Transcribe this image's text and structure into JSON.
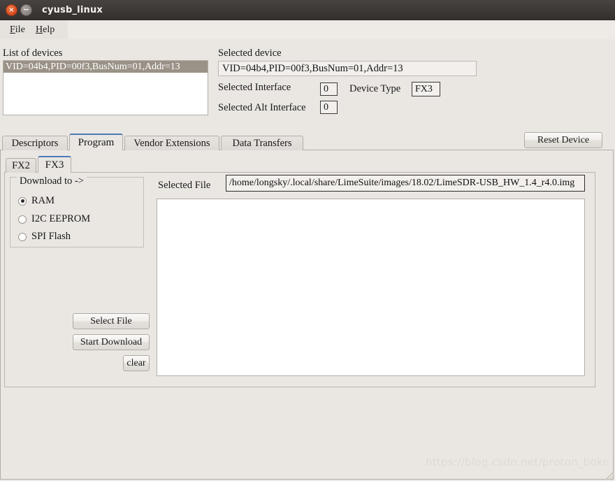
{
  "titlebar": {
    "title": "cyusb_linux",
    "close_glyph": "×",
    "minimize_glyph": "−",
    "close_icon_name": "close-icon",
    "minimize_icon_name": "minimize-icon"
  },
  "menubar": {
    "items": [
      {
        "label": "File",
        "mnemonic": "F",
        "rest": "ile"
      },
      {
        "label": "Help",
        "mnemonic": "H",
        "rest": "elp"
      }
    ]
  },
  "device_panel": {
    "list_label": "List of devices",
    "devices": [
      {
        "text": "VID=04b4,PID=00f3,BusNum=01,Addr=13",
        "selected": true
      }
    ],
    "selected_device_label": "Selected device",
    "selected_device_value": "VID=04b4,PID=00f3,BusNum=01,Addr=13",
    "selected_interface_label": "Selected Interface",
    "selected_interface_value": "0",
    "selected_alt_interface_label": "Selected Alt Interface",
    "selected_alt_interface_value": "0",
    "device_type_label": "Device Type",
    "device_type_value": "FX3"
  },
  "toolbar": {
    "reset_device_label": "Reset Device"
  },
  "main_tabs": [
    {
      "label": "Descriptors",
      "active": false
    },
    {
      "label": "Program",
      "active": true
    },
    {
      "label": "Vendor Extensions",
      "active": false
    },
    {
      "label": "Data Transfers",
      "active": false
    }
  ],
  "sub_tabs": [
    {
      "label": "FX2",
      "active": false
    },
    {
      "label": "FX3",
      "active": true
    }
  ],
  "program_panel": {
    "download_group_title": "Download to ->",
    "download_options": [
      {
        "label": "RAM",
        "selected": true
      },
      {
        "label": "I2C EEPROM",
        "selected": false
      },
      {
        "label": "SPI Flash",
        "selected": false
      }
    ],
    "selected_file_label": "Selected File",
    "selected_file_value": "/home/longsky/.local/share/LimeSuite/images/18.02/LimeSDR-USB_HW_1.4_r4.0.img",
    "output_text": "",
    "select_file_label": "Select File",
    "start_download_label": "Start Download",
    "clear_label": "clear"
  },
  "watermark": {
    "text": "https://blog.csdn.net/proton_boke"
  },
  "colors": {
    "window_background": "#eae7e3",
    "titlebar": "#3c3836",
    "accent_tab": "#4a7ab5",
    "list_selection": "#9a9287",
    "close_button": "#da5024"
  }
}
